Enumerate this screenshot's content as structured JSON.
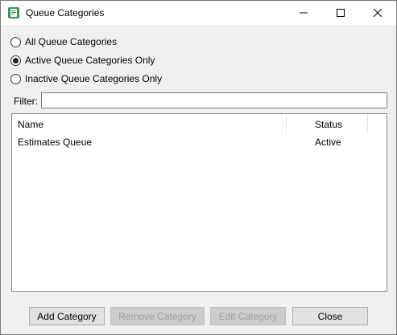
{
  "window": {
    "title": "Queue Categories",
    "icon": "queue-app-icon"
  },
  "filter_options": [
    {
      "label": "All Queue Categories",
      "checked": false
    },
    {
      "label": "Active Queue Categories Only",
      "checked": true
    },
    {
      "label": "Inactive Queue Categories Only",
      "checked": false
    }
  ],
  "filter": {
    "label": "Filter:",
    "value": ""
  },
  "table": {
    "columns": [
      "Name",
      "Status"
    ],
    "rows": [
      {
        "name": "Estimates Queue",
        "status": "Active"
      }
    ]
  },
  "buttons": {
    "add": "Add Category",
    "remove": "Remove Category",
    "edit": "Edit Category",
    "close": "Close"
  },
  "colors": {
    "app_icon": "#2e9b4a",
    "disabled_text": "#a0a0a0"
  }
}
